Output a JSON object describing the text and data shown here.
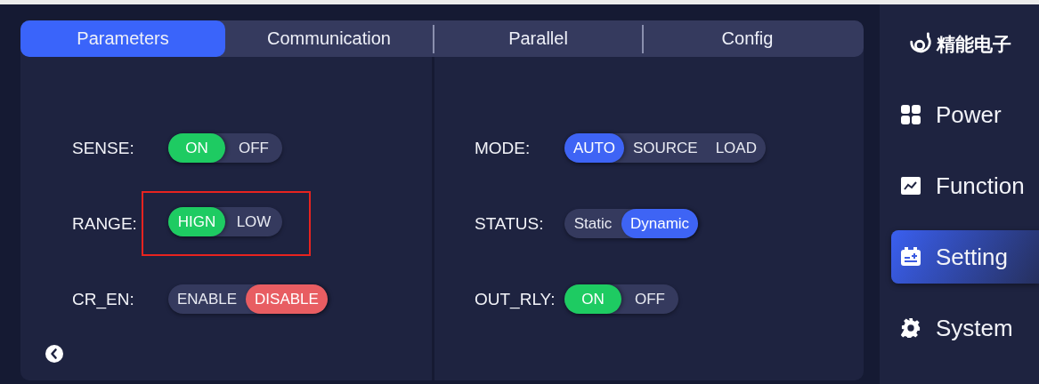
{
  "tabs": [
    {
      "label": "Parameters",
      "selected": true
    },
    {
      "label": "Communication",
      "selected": false
    },
    {
      "label": "Parallel",
      "selected": false
    },
    {
      "label": "Config",
      "selected": false
    }
  ],
  "left_column": [
    {
      "label": "SENSE:",
      "color": "#1ecb62",
      "highlighted": false,
      "options": [
        {
          "label": "ON",
          "selected": true
        },
        {
          "label": "OFF",
          "selected": false
        }
      ]
    },
    {
      "label": "RANGE:",
      "color": "#1ecb62",
      "highlighted": true,
      "options": [
        {
          "label": "HIGN",
          "selected": true
        },
        {
          "label": "LOW",
          "selected": false
        }
      ]
    },
    {
      "label": "CR_EN:",
      "color": "#e85d62",
      "highlighted": false,
      "options": [
        {
          "label": "ENABLE",
          "selected": false
        },
        {
          "label": "DISABLE",
          "selected": true
        }
      ]
    }
  ],
  "right_column": [
    {
      "label": "MODE:",
      "color": "#3e64f5",
      "highlighted": false,
      "options": [
        {
          "label": "AUTO",
          "selected": true
        },
        {
          "label": "SOURCE",
          "selected": false
        },
        {
          "label": "LOAD",
          "selected": false
        }
      ]
    },
    {
      "label": "STATUS:",
      "color": "#3e64f5",
      "highlighted": false,
      "options": [
        {
          "label": "Static",
          "selected": false
        },
        {
          "label": "Dynamic",
          "selected": true
        }
      ]
    },
    {
      "label": "OUT_RLY:",
      "color": "#1ecb62",
      "highlighted": false,
      "options": [
        {
          "label": "ON",
          "selected": true
        },
        {
          "label": "OFF",
          "selected": false
        }
      ]
    }
  ],
  "sidebar": {
    "logo_text": "精能电子",
    "items": [
      {
        "label": "Power",
        "selected": false
      },
      {
        "label": "Function",
        "selected": false
      },
      {
        "label": "Setting",
        "selected": true
      },
      {
        "label": "System",
        "selected": false
      }
    ]
  }
}
